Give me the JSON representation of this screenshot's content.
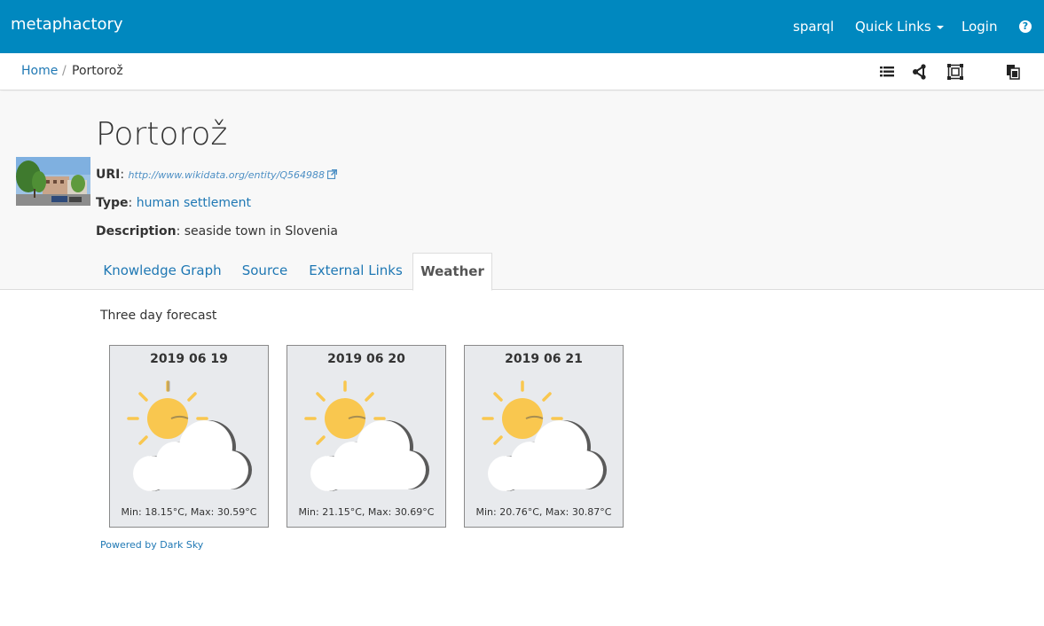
{
  "navbar": {
    "brand": "metaphactory",
    "sparql": "sparql",
    "quick_links": "Quick Links",
    "login": "Login",
    "help": "?"
  },
  "breadcrumb": {
    "home": "Home",
    "separator": "/",
    "current": "Portorož"
  },
  "toolbar": {
    "icons": [
      "list-icon",
      "graph-icon",
      "frame-icon",
      "copy-icon"
    ]
  },
  "entity": {
    "title": "Portorož",
    "uri_label": "URI",
    "uri_value": "http://www.wikidata.org/entity/Q564988",
    "type_label": "Type",
    "type_value": "human settlement",
    "description_label": "Description",
    "description_value": "seaside town in Slovenia"
  },
  "tabs": [
    {
      "label": "Knowledge Graph",
      "active": false
    },
    {
      "label": "Source",
      "active": false
    },
    {
      "label": "External Links",
      "active": false
    },
    {
      "label": "Weather",
      "active": true
    }
  ],
  "weather": {
    "heading": "Three day forecast",
    "days": [
      {
        "date": "2019 06 19",
        "icon": "partly-cloudy-day-icon",
        "temps": "Min: 18.15°C, Max: 30.59°C"
      },
      {
        "date": "2019 06 20",
        "icon": "partly-cloudy-day-icon",
        "temps": "Min: 21.15°C, Max: 30.69°C"
      },
      {
        "date": "2019 06 21",
        "icon": "partly-cloudy-day-icon",
        "temps": "Min: 20.76°C, Max: 30.87°C"
      }
    ],
    "powered_by": "Powered by Dark Sky"
  },
  "colors": {
    "navbar": "#0088bf",
    "link": "#1f78b4",
    "sun": "#f9c74f",
    "card_bg": "#e8eaed"
  }
}
